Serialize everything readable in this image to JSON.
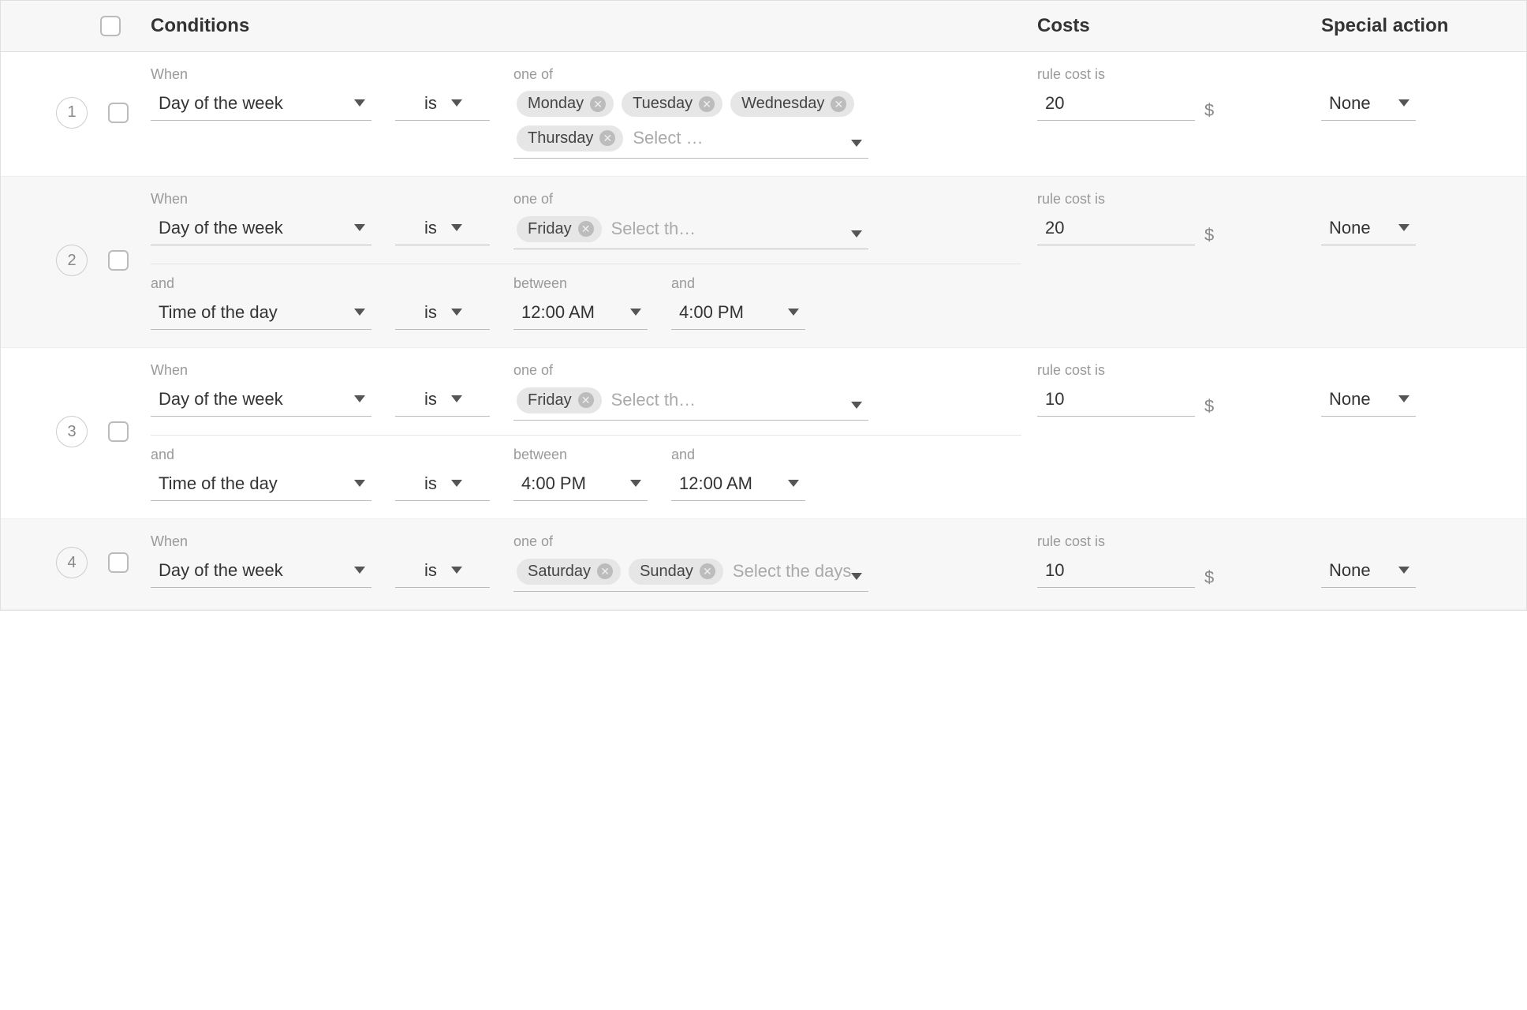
{
  "header": {
    "conditions": "Conditions",
    "costs": "Costs",
    "special": "Special action"
  },
  "labels": {
    "when": "When",
    "oneof": "one of",
    "rulecost": "rule cost is",
    "and": "and",
    "between": "between",
    "and2": "and",
    "select_days_short": "Select …",
    "select_th": "Select th…",
    "select_days_full": "Select the days"
  },
  "common": {
    "dayofweek": "Day of the week",
    "timeofday": "Time of the day",
    "is": "is",
    "dollar": "$",
    "none": "None"
  },
  "rows": [
    {
      "num": "1",
      "days": [
        "Monday",
        "Tuesday",
        "Wednesday",
        "Thursday"
      ],
      "days_ph": "select_days_short",
      "cost": "20",
      "action": "None",
      "sub": null
    },
    {
      "num": "2",
      "days": [
        "Friday"
      ],
      "days_ph": "select_th",
      "cost": "20",
      "action": "None",
      "sub": {
        "t1": "12:00 AM",
        "t2": "4:00 PM"
      }
    },
    {
      "num": "3",
      "days": [
        "Friday"
      ],
      "days_ph": "select_th",
      "cost": "10",
      "action": "None",
      "sub": {
        "t1": "4:00 PM",
        "t2": "12:00 AM"
      }
    },
    {
      "num": "4",
      "days": [
        "Saturday",
        "Sunday"
      ],
      "days_ph": "select_days_full",
      "cost": "10",
      "action": "None",
      "sub": null
    }
  ]
}
